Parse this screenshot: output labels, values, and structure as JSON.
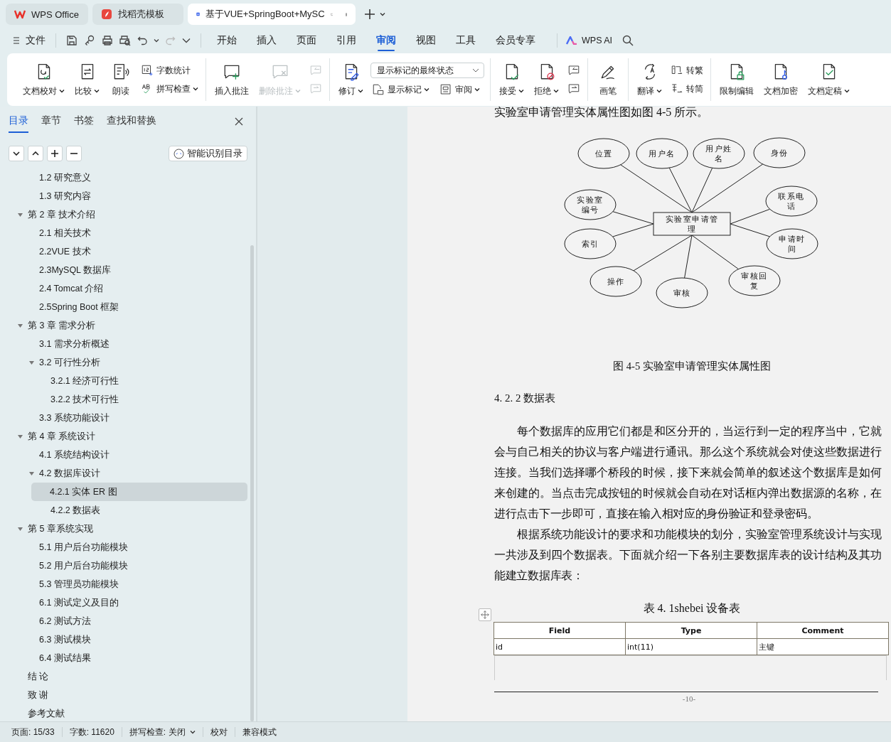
{
  "title_tabs": [
    {
      "label": "WPS Office",
      "selected": false
    },
    {
      "label": "找稻壳模板",
      "selected": false
    },
    {
      "label": "基于VUE+SpringBoot+MySC",
      "selected": true
    }
  ],
  "menu": {
    "file": "文件",
    "tabs": [
      {
        "label": "开始",
        "selected": false
      },
      {
        "label": "插入",
        "selected": false
      },
      {
        "label": "页面",
        "selected": false
      },
      {
        "label": "引用",
        "selected": false
      },
      {
        "label": "审阅",
        "selected": true
      },
      {
        "label": "视图",
        "selected": false
      },
      {
        "label": "工具",
        "selected": false
      },
      {
        "label": "会员专享",
        "selected": false
      }
    ],
    "ai": "WPS AI"
  },
  "ribbon": {
    "groups": [
      {
        "items": [
          {
            "kind": "large",
            "label": "文档校对",
            "dropdown": true,
            "disabled": false
          },
          {
            "kind": "large",
            "label": "比较",
            "dropdown": true,
            "disabled": false
          },
          {
            "kind": "large",
            "label": "朗读",
            "dropdown": false,
            "disabled": false
          },
          {
            "kind": "stack",
            "items": [
              {
                "label": "字数统计",
                "dropdown": false,
                "disabled": false
              },
              {
                "label": "拼写检查",
                "dropdown": true,
                "disabled": false
              }
            ]
          }
        ]
      },
      {
        "items": [
          {
            "kind": "large",
            "label": "插入批注",
            "dropdown": false,
            "disabled": false
          },
          {
            "kind": "large",
            "label": "删除批注",
            "dropdown": true,
            "disabled": true
          },
          {
            "kind": "stack",
            "items": [
              {
                "disabled": true
              },
              {
                "disabled": true
              }
            ]
          }
        ]
      },
      {
        "items": [
          {
            "kind": "large",
            "label": "修订",
            "dropdown": true,
            "disabled": false
          },
          {
            "kind": "select",
            "value": "显示标记的最终状态",
            "items": [
              {
                "label": "显示标记",
                "dropdown": true,
                "disabled": false
              },
              {
                "label": "审阅",
                "dropdown": true,
                "disabled": false
              }
            ]
          }
        ]
      },
      {
        "items": [
          {
            "kind": "large",
            "label": "接受",
            "dropdown": true,
            "disabled": false
          },
          {
            "kind": "large",
            "label": "拒绝",
            "dropdown": true,
            "disabled": false
          },
          {
            "kind": "stack",
            "items": [
              {
                "disabled": false
              },
              {
                "disabled": false
              }
            ]
          }
        ]
      },
      {
        "items": [
          {
            "kind": "large",
            "label": "画笔",
            "dropdown": false,
            "disabled": false
          }
        ]
      },
      {
        "items": [
          {
            "kind": "large",
            "label": "翻译",
            "dropdown": true,
            "disabled": false
          },
          {
            "kind": "stack",
            "items": [
              {
                "label": "转繁",
                "dropdown": false,
                "disabled": false
              },
              {
                "label": "转简",
                "dropdown": false,
                "disabled": false
              }
            ]
          }
        ]
      },
      {
        "items": [
          {
            "kind": "large",
            "label": "限制编辑",
            "dropdown": false,
            "disabled": false
          },
          {
            "kind": "large",
            "label": "文档加密",
            "dropdown": false,
            "disabled": false
          },
          {
            "kind": "large",
            "label": "文档定稿",
            "dropdown": true,
            "disabled": false
          }
        ]
      }
    ]
  },
  "sidebar": {
    "tabs": [
      {
        "label": "目录",
        "selected": true
      },
      {
        "label": "章节",
        "selected": false
      },
      {
        "label": "书签",
        "selected": false
      },
      {
        "label": "查找和替换",
        "selected": false
      }
    ],
    "smart_button": "智能识别目录",
    "tree": [
      {
        "children": [
          {
            "label": "1.2 研究意义",
            "selected": false
          },
          {
            "label": "1.3 研究内容",
            "selected": false
          }
        ]
      },
      {
        "label": "第 2 章  技术介绍",
        "selected": false,
        "expanded": true,
        "children": [
          {
            "label": "2.1 相关技术",
            "selected": false
          },
          {
            "label": "2.2VUE 技术",
            "selected": false
          },
          {
            "label": "2.3MySQL 数据库",
            "selected": false
          },
          {
            "label": "2.4 Tomcat 介绍",
            "selected": false
          },
          {
            "label": "2.5Spring Boot 框架",
            "selected": false
          }
        ]
      },
      {
        "label": "第 3 章  需求分析",
        "selected": false,
        "expanded": true,
        "children": [
          {
            "label": "3.1 需求分析概述",
            "selected": false
          },
          {
            "label": "3.2 可行性分析",
            "selected": false,
            "expanded": true,
            "children": [
              {
                "label": "3.2.1 经济可行性",
                "selected": false
              },
              {
                "label": "3.2.2 技术可行性",
                "selected": false
              }
            ]
          },
          {
            "label": "3.3 系统功能设计",
            "selected": false
          }
        ]
      },
      {
        "label": "第 4 章  系统设计",
        "selected": false,
        "expanded": true,
        "children": [
          {
            "label": "4.1 系统结构设计",
            "selected": false
          },
          {
            "label": "4.2 数据库设计",
            "selected": false,
            "expanded": true,
            "children": [
              {
                "label": "4.2.1 实体 ER 图",
                "selected": true
              },
              {
                "label": "4.2.2 数据表",
                "selected": false
              }
            ]
          }
        ]
      },
      {
        "label": "第 5 章系统实现",
        "selected": false,
        "expanded": true,
        "children": [
          {
            "label": "5.1 用户后台功能模块",
            "selected": false
          },
          {
            "label": "5.2 用户后台功能模块",
            "selected": false
          },
          {
            "label": "5.3 管理员功能模块",
            "selected": false
          },
          {
            "label": "6.1 测试定义及目的",
            "selected": false
          },
          {
            "label": "6.2 测试方法",
            "selected": false
          },
          {
            "label": "6.3 测试模块",
            "selected": false
          },
          {
            "label": "6.4 测试结果",
            "selected": false
          }
        ]
      },
      {
        "label": "结  论",
        "selected": false
      },
      {
        "label": "致  谢",
        "selected": false
      },
      {
        "label": "参考文献",
        "selected": false
      }
    ]
  },
  "document": {
    "intro_line": "实验室申请管理实体属性图如图 4-5 所示。",
    "figure": {
      "entity": "实验室申请管理",
      "attributes": [
        "位置",
        "用户名",
        "用户姓名",
        "身份",
        "实验室编号",
        "索引",
        "操作",
        "审核",
        "审核回复",
        "联系电话",
        "申请时间"
      ],
      "caption": "图 4-5 实验室申请管理实体属性图"
    },
    "heading": "4. 2. 2 数据表",
    "paragraphs": [
      "每个数据库的应用它们都是和区分开的，当运行到一定的程序当中，它就会与自己相关的协议与客户端进行通讯。那么这个系统就会对使这些数据进行连接。当我们选择哪个桥段的时候，接下来就会简单的叙述这个数据库是如何来创建的。当点击完成按钮的时候就会自动在对话框内弹出数据源的名称，在进行点击下一步即可，直接在输入相对应的身份验证和登录密码。",
      "根据系统功能设计的要求和功能模块的划分，实验室管理系统设计与实现一共涉及到四个数据表。下面就介绍一下各别主要数据库表的设计结构及其功能建立数据库表："
    ],
    "table_caption": "表 4. 1shebei 设备表",
    "table": {
      "columns": [
        "Field",
        "Type",
        "Comment"
      ],
      "rows": [
        [
          "id",
          "int(11)",
          "主键"
        ]
      ]
    },
    "page_number": "-10-"
  },
  "status_bar": [
    {
      "label": "页面: 15/33",
      "dropdown": false
    },
    {
      "label": "字数: 11620",
      "dropdown": false
    },
    {
      "label": "拼写检查: 关闭",
      "dropdown": true
    },
    {
      "label": "校对",
      "dropdown": false
    },
    {
      "label": "兼容模式",
      "dropdown": false
    }
  ]
}
